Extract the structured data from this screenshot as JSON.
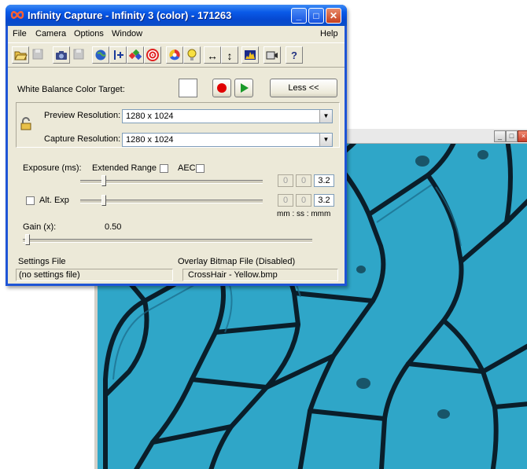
{
  "main_window": {
    "title": "Infinity Capture - Infinity 3 (color) - 171263",
    "controls": {
      "minimize": "_",
      "maximize": "□",
      "close": "✕"
    }
  },
  "menu": {
    "items": [
      "File",
      "Camera",
      "Options",
      "Window"
    ],
    "help": "Help"
  },
  "toolbar": {
    "icons": [
      "open-folder-icon",
      "save-icon",
      "camera-icon",
      "save-image-icon",
      "color-globe-icon",
      "crosshair-add-icon",
      "color-picker-icon",
      "target-icon",
      "color-wheel-icon",
      "bulb-icon",
      "horizontal-flip-icon",
      "vertical-flip-icon",
      "histogram-icon",
      "video-icon",
      "help-icon"
    ]
  },
  "white_balance": {
    "label": "White Balance Color Target:",
    "less_button": "Less <<"
  },
  "resolution": {
    "preview_label": "Preview Resolution:",
    "preview_value": "1280 x 1024",
    "capture_label": "Capture Resolution:",
    "capture_value": "1280 x 1024"
  },
  "exposure": {
    "label": "Exposure (ms):",
    "extended_range": "Extended Range",
    "aec": "AEC",
    "values": [
      "0",
      "0",
      "3.2"
    ],
    "alt_exp_label": "Alt. Exp",
    "alt_values": [
      "0",
      "0",
      "3.2"
    ],
    "time_format": "mm : ss  : mmm"
  },
  "gain": {
    "label": "Gain (x):",
    "value": "0.50"
  },
  "footer": {
    "settings_file_label": "Settings File",
    "settings_file_value": "(no settings file)",
    "overlay_label": "Overlay Bitmap File (Disabled)",
    "overlay_value": "CrossHair - Yellow.bmp"
  },
  "colors": {
    "title_bar": "#0a5ae8",
    "window_face": "#ece9d8",
    "micro_bg": "#2fa6c8",
    "cell_wall": "#0a1e2a",
    "record_red": "#e00000",
    "play_green": "#1a9a2a"
  }
}
